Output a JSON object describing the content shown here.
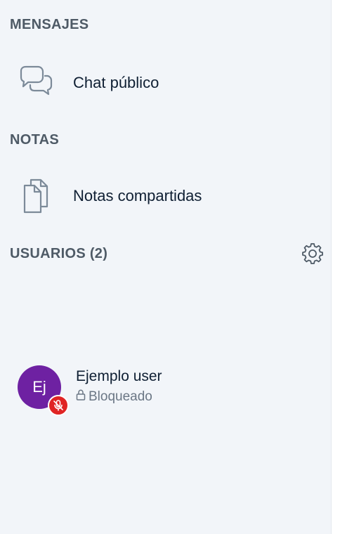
{
  "sections": {
    "messages": {
      "title": "MENSAJES",
      "items": [
        {
          "label": "Chat público",
          "icon": "chat-bubbles-icon"
        }
      ]
    },
    "notes": {
      "title": "NOTAS",
      "items": [
        {
          "label": "Notas compartidas",
          "icon": "document-icon"
        }
      ]
    },
    "users": {
      "title": "USUARIOS (2)",
      "settings_icon": "gear-icon",
      "list": [
        {
          "initials": "Ej",
          "name": "Ejemplo user",
          "status": "Bloqueado",
          "status_icon": "lock-icon",
          "badge_icon": "muted-microphone-icon",
          "avatar_color": "#6e21a2",
          "badge_color": "#e02424"
        }
      ]
    }
  }
}
